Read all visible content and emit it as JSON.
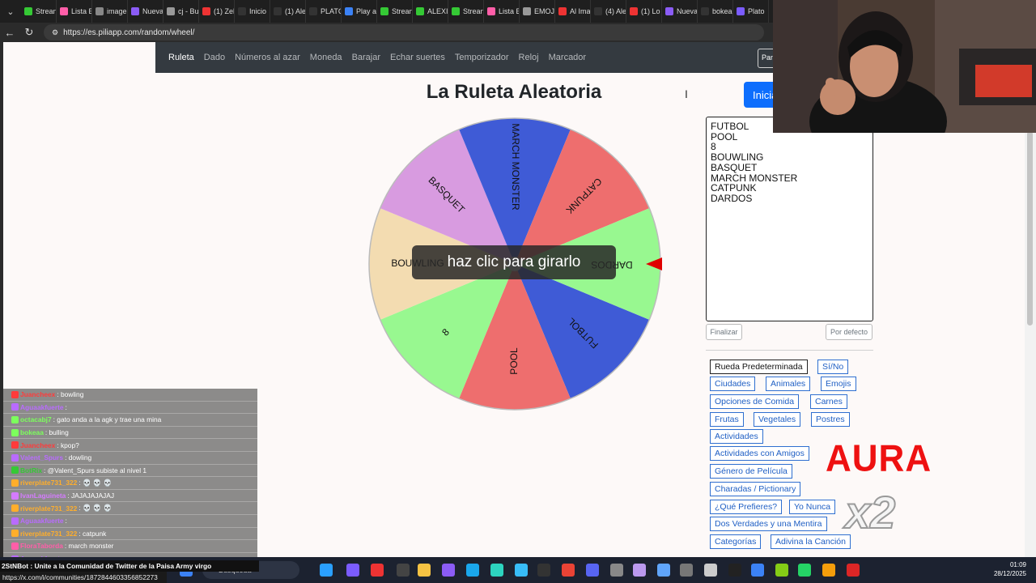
{
  "browser": {
    "tabs": [
      "Strean",
      "Lista E",
      "image",
      "Nueva",
      "cj - Bu",
      "(1) Zel",
      "Inicio",
      "(1) Ale",
      "PLATC",
      "Play a",
      "Strean",
      "ALEXIT",
      "Strean",
      "Lista E",
      "EMOJ",
      "Al Ima",
      "(4) Ale",
      "(1) Lo",
      "Nueva",
      "bokea",
      "Plato"
    ],
    "url": "https://es.piliapp.com/random/wheel/"
  },
  "nav": {
    "items": [
      "Ruleta",
      "Dado",
      "Números al azar",
      "Moneda",
      "Barajar",
      "Echar suertes",
      "Temporizador",
      "Reloj",
      "Marcador"
    ],
    "active": "Ruleta",
    "right_box": "Pan"
  },
  "title": "La Ruleta Aleatoria",
  "start_button": "Inicia",
  "wheel": {
    "segments": [
      {
        "label": "FUTBOL",
        "color": "#3f5bd6"
      },
      {
        "label": "POOL",
        "color": "#ee6e6e"
      },
      {
        "label": "8",
        "color": "#98f890"
      },
      {
        "label": "BOUWLING",
        "color": "#f3dcb1"
      },
      {
        "label": "BASQUET",
        "color": "#d89be0"
      },
      {
        "label": "MARCH MONSTER",
        "color": "#3f5bd6"
      },
      {
        "label": "CATPUNK",
        "color": "#ee6e6e"
      },
      {
        "label": "DARDOS",
        "color": "#98f890"
      }
    ],
    "pointer_color": "#e00000",
    "overlay": "haz clic para girarlo"
  },
  "entries": [
    "FUTBOL",
    "POOL",
    "8",
    "BOUWLING",
    "BASQUET",
    "MARCH MONSTER",
    "CATPUNK",
    "DARDOS"
  ],
  "buttons": {
    "finish": "Finalizar",
    "default": "Por defecto"
  },
  "presets": [
    "Rueda Predeterminada",
    "Sí/No",
    "Ciudades",
    "Animales",
    "Emojis",
    "Opciones de Comida",
    "Carnes",
    "Frutas",
    "Vegetales",
    "Postres",
    "Actividades",
    "Actividades con Amigos",
    "Género de Película",
    "Charadas / Pictionary",
    "¿Qué Prefieres?",
    "Yo Nunca",
    "Dos Verdades y una Mentira",
    "Categorías",
    "Adivina la Canción"
  ],
  "overlays": {
    "aura": "AURA",
    "x2": "x2"
  },
  "chat": [
    {
      "user": "Juancheex",
      "msg": ": bowling",
      "color": "#ff3b3b"
    },
    {
      "user": "Aguaakfuerte",
      "msg": ":",
      "color": "#b96bff"
    },
    {
      "user": "octacabj7",
      "msg": ": gato anda a la agk y trae una mina",
      "color": "#7cff5c"
    },
    {
      "user": "bokeaa",
      "msg": ": bulling",
      "color": "#7cff5c"
    },
    {
      "user": "Juancheex",
      "msg": ": kpop?",
      "color": "#ff3b3b"
    },
    {
      "user": "Valent_Spurs",
      "msg": ": dowling",
      "color": "#b96bff"
    },
    {
      "user": "BotRix",
      "msg": ": @Valent_Spurs subiste al nivel 1",
      "color": "#35c935"
    },
    {
      "user": "riverplate731_322",
      "msg": ": 💀 💀 💀",
      "color": "#ffae2b"
    },
    {
      "user": "IvanLaguineta",
      "msg": ": JAJAJAJAJAJ",
      "color": "#d57bff"
    },
    {
      "user": "riverplate731_322",
      "msg": ": 💀 💀 💀",
      "color": "#ffae2b"
    },
    {
      "user": "Aguaakfuerte",
      "msg": ":",
      "color": "#b96bff"
    },
    {
      "user": "riverplate731_322",
      "msg": ": catpunk",
      "color": "#ffae2b"
    },
    {
      "user": "FloraTaborda",
      "msg": ": march monster",
      "color": "#ff5ea8"
    },
    {
      "user": "Aguaakfuerte",
      "msg": ":",
      "color": "#b96bff"
    }
  ],
  "status": {
    "bottom_text": "2StNBot : Unite a la Comunidad de Twitter de la Paisa Army virgo",
    "link": "https://x.com/i/communities/1872844603356852273",
    "search": "Búsqueda",
    "time": "01:09",
    "date": "28/12/2025"
  }
}
